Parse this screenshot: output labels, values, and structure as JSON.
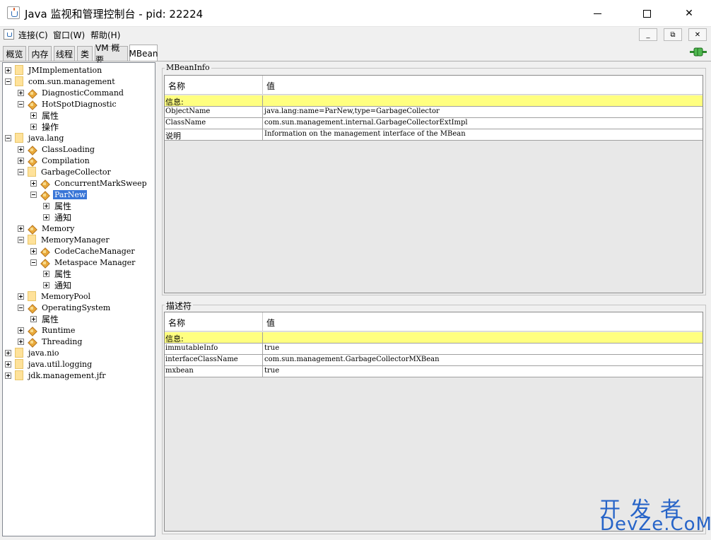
{
  "window": {
    "title": "Java 监视和管理控制台 - pid: 22224",
    "min_label": "–",
    "close_label": "✕"
  },
  "menu": {
    "items": [
      "连接(C)",
      "窗口(W)",
      "帮助(H)"
    ],
    "mdi_buttons": [
      "_",
      "⧉",
      "✕"
    ]
  },
  "tabs": [
    "概览",
    "内存",
    "线程",
    "类",
    "VM 概要",
    "MBean"
  ],
  "active_tab": "MBean",
  "tree": [
    {
      "label": "JMImplementation",
      "depth": 0,
      "kind": "folder",
      "expander": "plus"
    },
    {
      "label": "com.sun.management",
      "depth": 0,
      "kind": "folder",
      "expander": "minus"
    },
    {
      "label": "DiagnosticCommand",
      "depth": 1,
      "kind": "bean",
      "expander": "plus"
    },
    {
      "label": "HotSpotDiagnostic",
      "depth": 1,
      "kind": "bean",
      "expander": "minus"
    },
    {
      "label": "属性",
      "depth": 2,
      "kind": "none",
      "expander": "plus"
    },
    {
      "label": "操作",
      "depth": 2,
      "kind": "none",
      "expander": "plus"
    },
    {
      "label": "java.lang",
      "depth": 0,
      "kind": "folder",
      "expander": "minus"
    },
    {
      "label": "ClassLoading",
      "depth": 1,
      "kind": "bean",
      "expander": "plus"
    },
    {
      "label": "Compilation",
      "depth": 1,
      "kind": "bean",
      "expander": "plus"
    },
    {
      "label": "GarbageCollector",
      "depth": 1,
      "kind": "folder",
      "expander": "minus"
    },
    {
      "label": "ConcurrentMarkSweep",
      "depth": 2,
      "kind": "bean",
      "expander": "plus"
    },
    {
      "label": "ParNew",
      "depth": 2,
      "kind": "bean",
      "expander": "minus",
      "selected": true
    },
    {
      "label": "属性",
      "depth": 3,
      "kind": "none",
      "expander": "plus"
    },
    {
      "label": "通知",
      "depth": 3,
      "kind": "none",
      "expander": "plus"
    },
    {
      "label": "Memory",
      "depth": 1,
      "kind": "bean",
      "expander": "plus"
    },
    {
      "label": "MemoryManager",
      "depth": 1,
      "kind": "folder",
      "expander": "minus"
    },
    {
      "label": "CodeCacheManager",
      "depth": 2,
      "kind": "bean",
      "expander": "plus"
    },
    {
      "label": "Metaspace Manager",
      "depth": 2,
      "kind": "bean",
      "expander": "minus"
    },
    {
      "label": "属性",
      "depth": 3,
      "kind": "none",
      "expander": "plus"
    },
    {
      "label": "通知",
      "depth": 3,
      "kind": "none",
      "expander": "plus"
    },
    {
      "label": "MemoryPool",
      "depth": 1,
      "kind": "folder",
      "expander": "plus"
    },
    {
      "label": "OperatingSystem",
      "depth": 1,
      "kind": "bean",
      "expander": "minus"
    },
    {
      "label": "属性",
      "depth": 2,
      "kind": "none",
      "expander": "plus"
    },
    {
      "label": "Runtime",
      "depth": 1,
      "kind": "bean",
      "expander": "plus"
    },
    {
      "label": "Threading",
      "depth": 1,
      "kind": "bean",
      "expander": "plus"
    },
    {
      "label": "java.nio",
      "depth": 0,
      "kind": "folder",
      "expander": "plus"
    },
    {
      "label": "java.util.logging",
      "depth": 0,
      "kind": "folder",
      "expander": "plus"
    },
    {
      "label": "jdk.management.jfr",
      "depth": 0,
      "kind": "folder",
      "expander": "plus"
    }
  ],
  "mbean_info": {
    "title": "MBeanInfo",
    "header": {
      "name": "名称",
      "value": "值"
    },
    "rows": [
      {
        "name": "信息:",
        "value": "",
        "info": true
      },
      {
        "name": "ObjectName",
        "value": "java.lang:name=ParNew,type=GarbageCollector"
      },
      {
        "name": "ClassName",
        "value": "com.sun.management.internal.GarbageCollectorExtImpl"
      },
      {
        "name": "说明",
        "value": "Information on the management interface of the MBean"
      }
    ]
  },
  "descriptor": {
    "title": "描述符",
    "header": {
      "name": "名称",
      "value": "值"
    },
    "rows": [
      {
        "name": "信息:",
        "value": "",
        "info": true
      },
      {
        "name": "immutableInfo",
        "value": "true"
      },
      {
        "name": "interfaceClassName",
        "value": "com.sun.management.GarbageCollectorMXBean"
      },
      {
        "name": "mxbean",
        "value": "true"
      }
    ]
  },
  "watermark": {
    "cn": "开发者",
    "en": "DevZe.CoM"
  },
  "icons": {
    "app": "java-console-icon",
    "connection": "connected-plug-icon",
    "tree_folder": "folder-icon",
    "tree_bean": "mbean-icon"
  },
  "colors": {
    "selection": "#3875d7",
    "info_row": "#ffff80",
    "watermark": "#2764c8"
  }
}
